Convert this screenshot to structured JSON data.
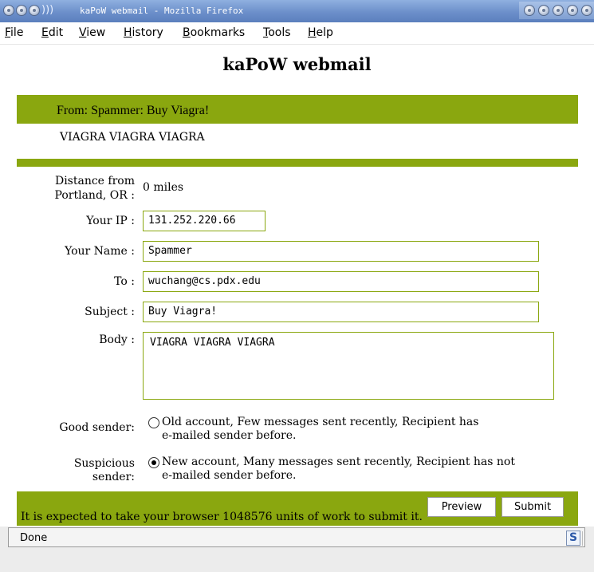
{
  "window": {
    "title": "kaPoW webmail - Mozilla Firefox",
    "icon": "firefox-swirl-icon",
    "right_controls": "window-control-icons"
  },
  "menu": [
    {
      "label": "File"
    },
    {
      "label": "Edit"
    },
    {
      "label": "View"
    },
    {
      "label": "History"
    },
    {
      "label": "Bookmarks"
    },
    {
      "label": "Tools"
    },
    {
      "label": "Help"
    }
  ],
  "page": {
    "title": "kaPoW webmail"
  },
  "message": {
    "from_line": "From: Spammer: Buy Viagra!",
    "body_preview": "VIAGRA VIAGRA VIAGRA"
  },
  "form": {
    "distance_label_line1": "Distance from",
    "distance_label_line2": "Portland, OR :",
    "distance_value": "0 miles",
    "ip_label": "Your IP :",
    "ip_value": "131.252.220.66",
    "name_label": "Your Name :",
    "name_value": "Spammer",
    "to_label": "To :",
    "to_value": "wuchang@cs.pdx.edu",
    "subject_label": "Subject :",
    "subject_value": "Buy Viagra!",
    "body_label": "Body :",
    "body_value": "VIAGRA VIAGRA VIAGRA"
  },
  "senders": {
    "good_label": "Good sender:",
    "good_text_line1": "Old account, Few messages sent recently, Recipient has",
    "good_text_line2": "e-mailed sender before.",
    "good_selected": false,
    "suspicious_label_line1": "Suspicious",
    "suspicious_label_line2": "sender:",
    "suspicious_text_line1": "New account, Many messages sent recently, Recipient has not",
    "suspicious_text_line2": "e-mailed sender before.",
    "suspicious_selected": true
  },
  "actions": {
    "preview_label": "Preview",
    "submit_label": "Submit",
    "work_notice": "It is expected to take your browser 1048576 units of work to submit it."
  },
  "colors": {
    "accent_green": "#8aa70f",
    "titlebar_blue": "#6c8fca"
  },
  "status": {
    "text": "Done",
    "addon_icon_letter": "S"
  }
}
